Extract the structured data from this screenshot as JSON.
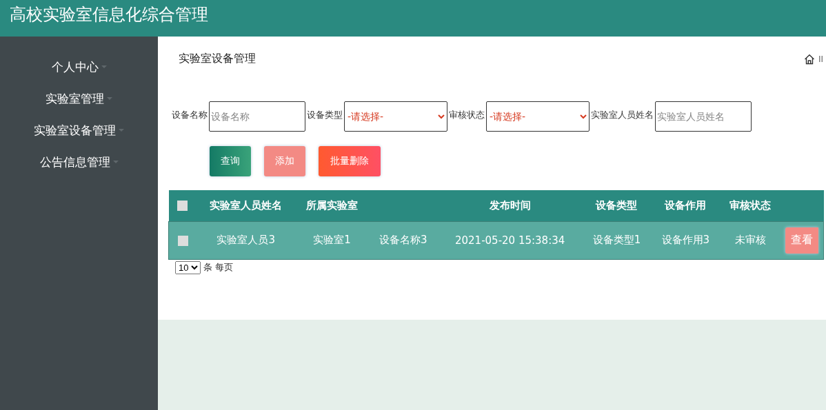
{
  "header": {
    "title": "高校实验室信息化综合管理"
  },
  "sidebar": {
    "items": [
      {
        "label": "个人中心",
        "expanded": false
      },
      {
        "label": "实验室管理",
        "expanded": false
      },
      {
        "label": "实验室设备管理",
        "expanded": false
      },
      {
        "label": "公告信息管理",
        "expanded": false
      }
    ]
  },
  "page": {
    "title": "实验室设备管理",
    "breadcrumb_separator": "II"
  },
  "filters": [
    {
      "label": "设备名称",
      "kind": "input",
      "placeholder": "设备名称"
    },
    {
      "label": "设备类型",
      "kind": "select",
      "value": "-请选择-"
    },
    {
      "label": "审核状态",
      "kind": "select",
      "value": "-请选择-"
    },
    {
      "label": "实验室人员姓名",
      "kind": "input",
      "placeholder": "实验室人员姓名"
    }
  ],
  "buttons": [
    {
      "label": "查询",
      "kind": "search"
    },
    {
      "label": "添加",
      "kind": "add"
    },
    {
      "label": "批量删除",
      "kind": "delete"
    }
  ],
  "table": {
    "columns": [
      "实验室人员姓名",
      "所属实验室",
      null,
      "发布时间",
      "设备类型",
      "设备作用",
      "审核状态"
    ],
    "select_all": {
      "checked": false
    },
    "rows": [
      {
        "checked": false,
        "cells": [
          "实验室人员3",
          "实验室1",
          "设备名称3",
          "2021-05-20 15:38:34",
          "设备类型1",
          "设备作用3",
          "未审核"
        ],
        "action": "查看"
      }
    ]
  },
  "pagination": {
    "page_size": "10",
    "suffix": "条 每页"
  }
}
